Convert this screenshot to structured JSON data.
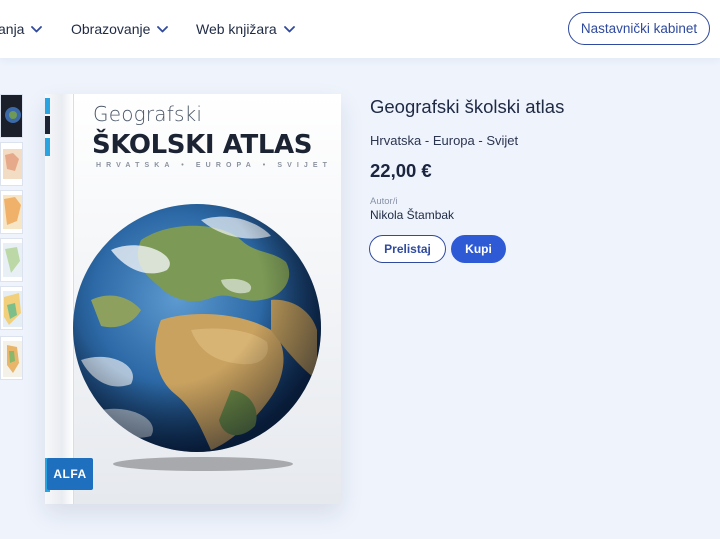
{
  "nav": {
    "items": [
      {
        "label": "anja"
      },
      {
        "label": "Obrazovanje"
      },
      {
        "label": "Web knjižara"
      }
    ],
    "cta_label": "Nastavnički kabinet"
  },
  "book_cover": {
    "title_small": "Geografski",
    "title_big": "ŠKOLSKI ATLAS",
    "subtitle": "HRVATSKA • EUROPA • SVIJET",
    "publisher_logo": "ALFA"
  },
  "product": {
    "title": "Geografski školski atlas",
    "subtitle": "Hrvatska - Europa - Svijet",
    "price": "22,00 €",
    "author_label": "Autor/i",
    "author": "Nikola Štambak",
    "browse_label": "Prelistaj",
    "buy_label": "Kupi"
  },
  "colors": {
    "accent": "#2f4a9e",
    "buy_button": "#2f5ad6",
    "page_background": "#eef3fc"
  },
  "icons": [
    "chevron-down-icon",
    "publisher-logo"
  ]
}
